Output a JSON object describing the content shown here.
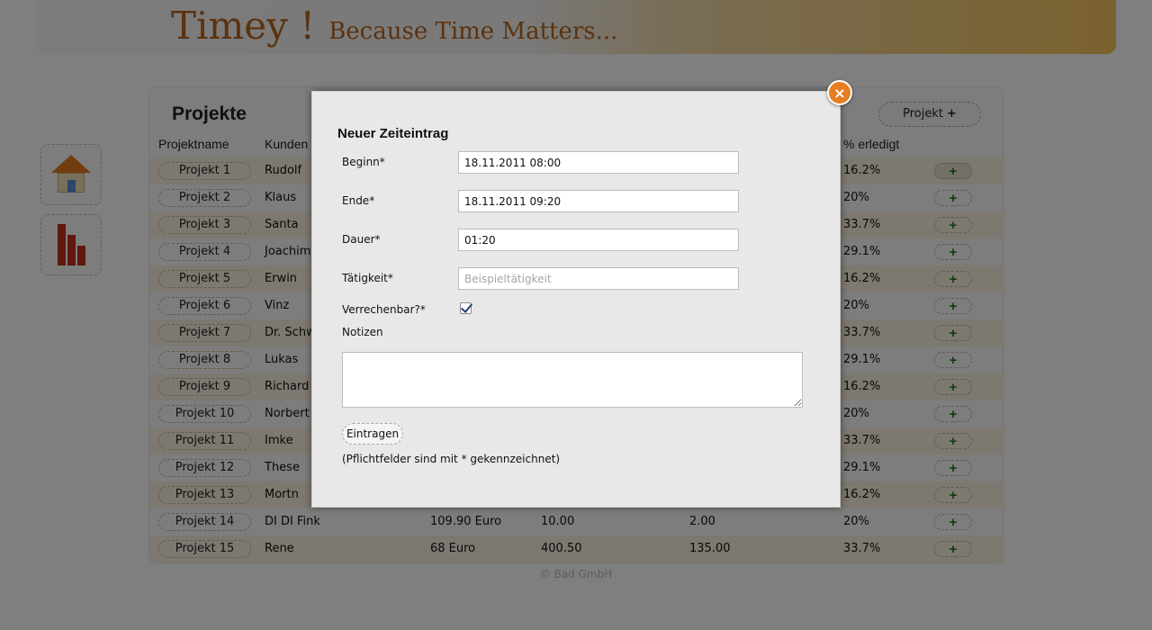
{
  "header": {
    "app_name": "Timey !",
    "tagline": "Because Time Matters..."
  },
  "sidebar": {
    "items": [
      {
        "icon": "house-icon"
      },
      {
        "icon": "bar-chart-icon"
      }
    ]
  },
  "projects": {
    "title": "Projekte",
    "add_button": "Projekt",
    "add_button_icon": "+",
    "columns": [
      "Projektname",
      "Kunden",
      "",
      "",
      "",
      "% erledigt"
    ],
    "rows": [
      {
        "name": "Projekt 1",
        "client": "Rudolf",
        "price": "",
        "hours": "",
        "done": "",
        "pct": "16.2%"
      },
      {
        "name": "Projekt 2",
        "client": "Klaus",
        "price": "",
        "hours": "",
        "done": "",
        "pct": "20%"
      },
      {
        "name": "Projekt 3",
        "client": "Santa",
        "price": "",
        "hours": "",
        "done": "",
        "pct": "33.7%"
      },
      {
        "name": "Projekt 4",
        "client": "Joachim",
        "price": "",
        "hours": "",
        "done": "",
        "pct": "29.1%"
      },
      {
        "name": "Projekt 5",
        "client": "Erwin",
        "price": "",
        "hours": "",
        "done": "",
        "pct": "16.2%"
      },
      {
        "name": "Projekt 6",
        "client": "Vinz",
        "price": "",
        "hours": "",
        "done": "",
        "pct": "20%"
      },
      {
        "name": "Projekt 7",
        "client": "Dr. Schw",
        "price": "",
        "hours": "",
        "done": "",
        "pct": "33.7%"
      },
      {
        "name": "Projekt 8",
        "client": "Lukas",
        "price": "",
        "hours": "",
        "done": "",
        "pct": "29.1%"
      },
      {
        "name": "Projekt 9",
        "client": "Richard",
        "price": "",
        "hours": "",
        "done": "",
        "pct": "16.2%"
      },
      {
        "name": "Projekt 10",
        "client": "Norbert",
        "price": "",
        "hours": "",
        "done": "",
        "pct": "20%"
      },
      {
        "name": "Projekt 11",
        "client": "Imke",
        "price": "",
        "hours": "",
        "done": "",
        "pct": "33.7%"
      },
      {
        "name": "Projekt 12",
        "client": "These",
        "price": "",
        "hours": "",
        "done": "",
        "pct": "29.1%"
      },
      {
        "name": "Projekt 13",
        "client": "Mortn",
        "price": "",
        "hours": "",
        "done": "",
        "pct": "16.2%"
      },
      {
        "name": "Projekt 14",
        "client": "DI DI Fink",
        "price": "109.90 Euro",
        "hours": "10.00",
        "done": "2.00",
        "pct": "20%"
      },
      {
        "name": "Projekt 15",
        "client": "Rene",
        "price": "68 Euro",
        "hours": "400.50",
        "done": "135.00",
        "pct": "33.7%"
      }
    ],
    "row_add_label": "+"
  },
  "footer": {
    "text": "© Bad GmbH"
  },
  "modal": {
    "close_label": "×",
    "title": "Neuer Zeiteintrag",
    "fields": {
      "start": {
        "label": "Beginn*",
        "value": "18.11.2011 08:00"
      },
      "end": {
        "label": "Ende*",
        "value": "18.11.2011 09:20"
      },
      "duration": {
        "label": "Dauer*",
        "value": "01:20"
      },
      "activity": {
        "label": "Tätigkeit*",
        "value": "",
        "placeholder": "Beispieltätigkeit"
      },
      "billable": {
        "label": "Verrechenbar?*",
        "checked": true
      },
      "notes": {
        "label": "Notizen",
        "value": ""
      }
    },
    "submit_label": "Eintragen",
    "hint": "(Pflichtfelder sind mit * gekennzeichnet)"
  },
  "colors": {
    "brand": "#b8651e",
    "close_button": "#e67e22",
    "row_alt": "#fbf1e1",
    "plus_green": "#1e7a1e"
  }
}
